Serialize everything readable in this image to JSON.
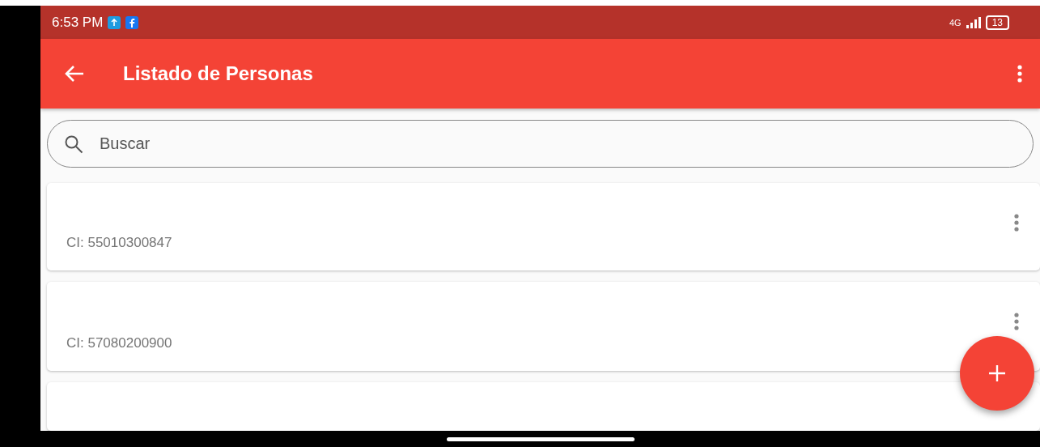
{
  "status_bar": {
    "time": "6:53 PM",
    "network": "4G",
    "battery": "13"
  },
  "app_bar": {
    "title": "Listado de Personas"
  },
  "search": {
    "placeholder": "Buscar"
  },
  "people": [
    {
      "ci": "CI: 55010300847"
    },
    {
      "ci": "CI: 57080200900"
    }
  ]
}
